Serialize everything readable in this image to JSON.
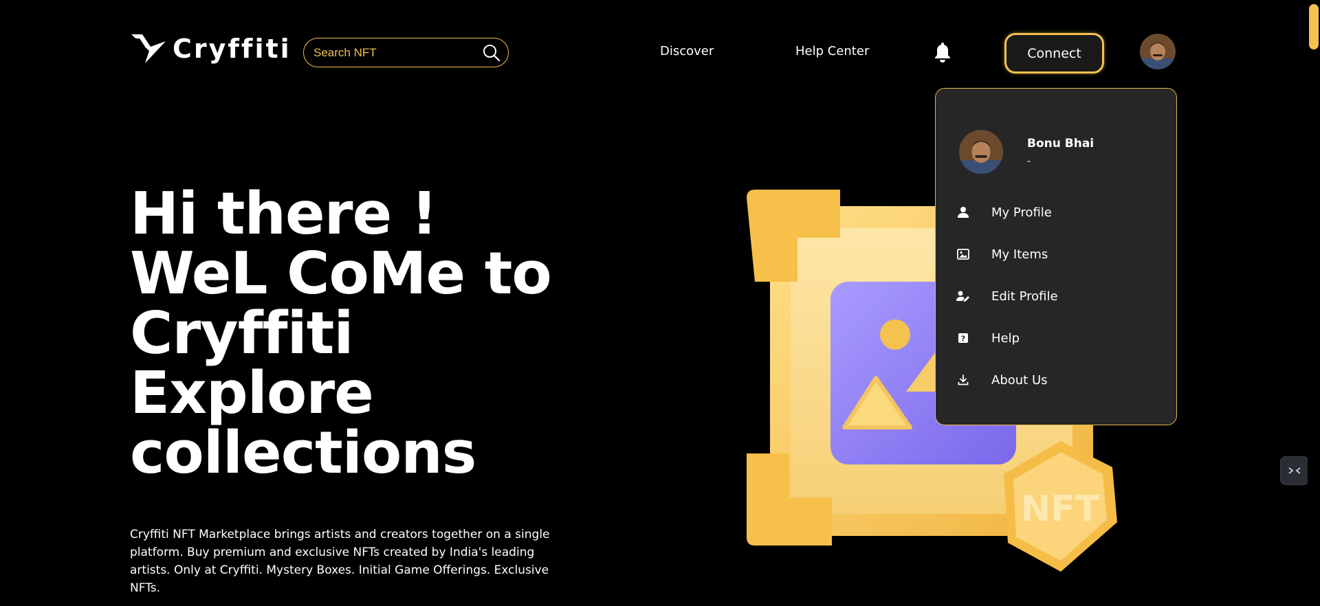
{
  "brand": {
    "name": "Cryffiti"
  },
  "search": {
    "placeholder": "Search NFT"
  },
  "nav": {
    "discover": "Discover",
    "help_center": "Help Center",
    "connect": "Connect"
  },
  "hero": {
    "headline": "Hi there ! WeL CoMe to Cryffiti Explore collections",
    "description": "Cryffiti NFT Marketplace brings artists and creators together on a single platform. Buy premium and exclusive NFTs created by India's leading artists. Only at Cryffiti. Mystery Boxes. Initial Game Offerings. Exclusive NFTs.",
    "badge_text": "NFT"
  },
  "profile_menu": {
    "user_name": "Bonu Bhai",
    "user_subtitle": "-",
    "items": [
      {
        "label": "My Profile",
        "icon": "user-icon"
      },
      {
        "label": "My Items",
        "icon": "image-icon"
      },
      {
        "label": "Edit Profile",
        "icon": "user-edit-icon"
      },
      {
        "label": "Help",
        "icon": "question-icon"
      },
      {
        "label": "About Us",
        "icon": "download-icon"
      }
    ]
  },
  "colors": {
    "background": "#000000",
    "accent": "#f2c14e",
    "menu_bg": "#262626",
    "frame": "#f4c24f",
    "image_purple": "#8b7cf0"
  }
}
